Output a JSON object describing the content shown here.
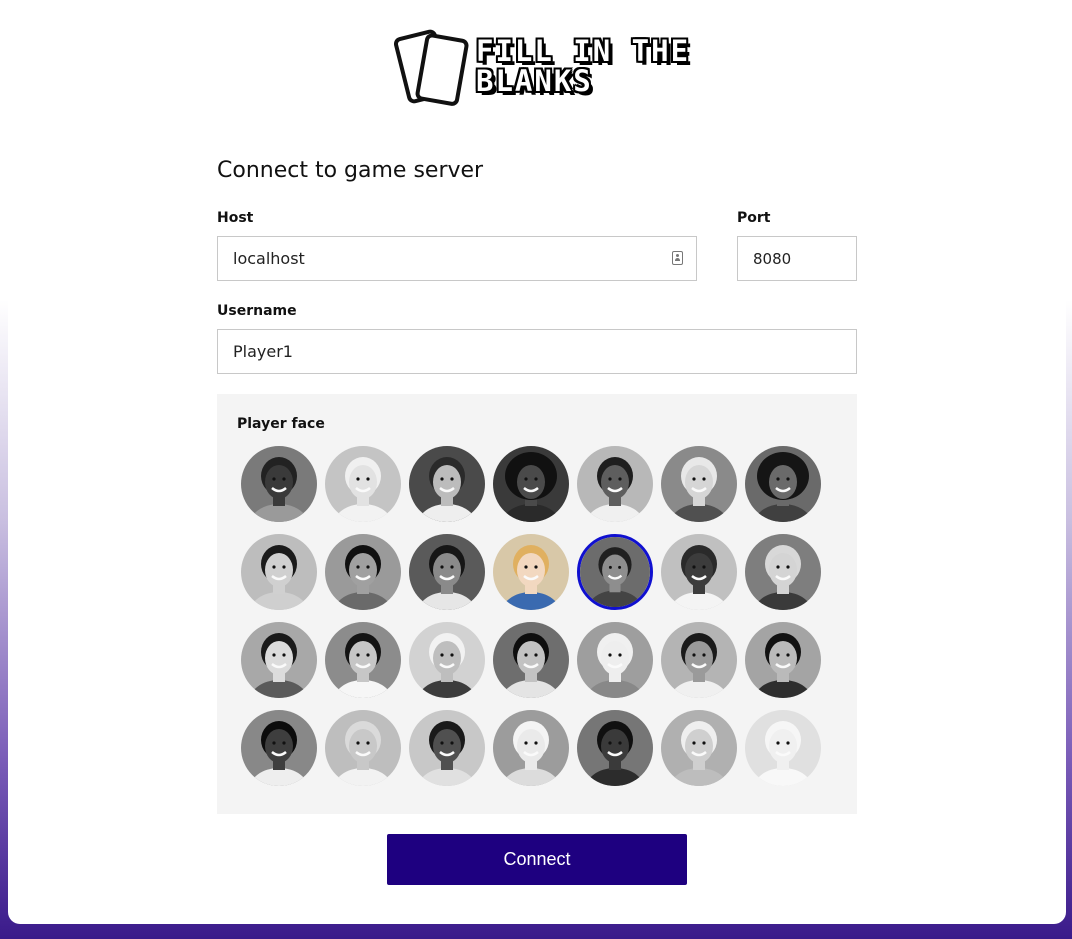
{
  "logo": {
    "line1": "FILL IN THE",
    "line2": "BLANKS"
  },
  "form": {
    "heading": "Connect to game server",
    "host_label": "Host",
    "host_value": "localhost",
    "port_label": "Port",
    "port_value": "8080",
    "username_label": "Username",
    "username_value": "Player1",
    "faces_label": "Player face",
    "connect_label": "Connect"
  },
  "faces": {
    "selected_index": 11,
    "count": 28,
    "selected_border_color": "#1010d0"
  },
  "colors": {
    "accent": "#1e0080",
    "background_gradient_end": "#3a1a8a"
  }
}
